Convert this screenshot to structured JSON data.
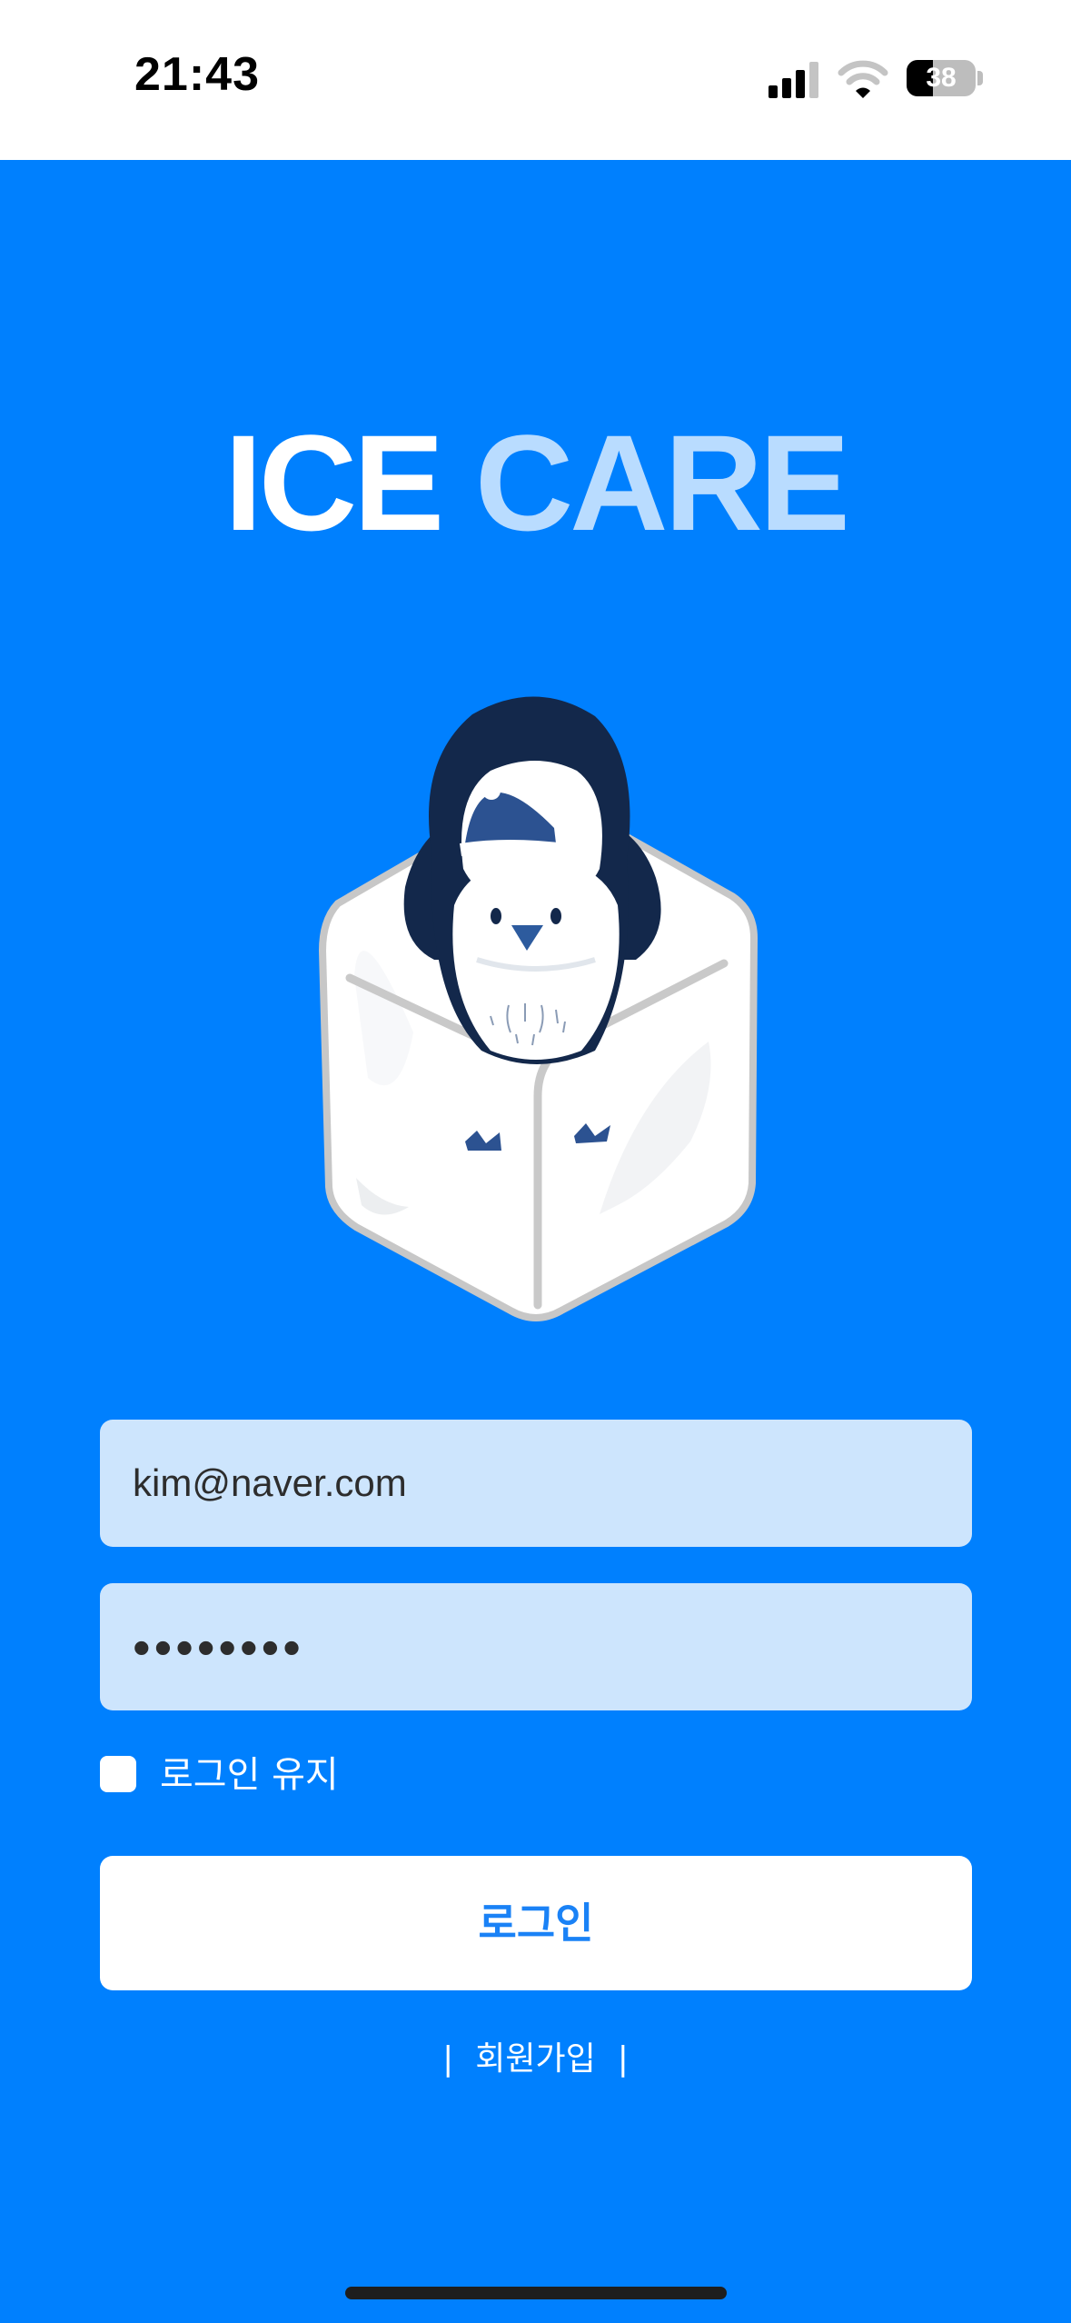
{
  "status_bar": {
    "time": "21:43",
    "battery_level": "38",
    "battery_fraction": 0.38
  },
  "logo": {
    "word1": "ICE",
    "word2": "CARE"
  },
  "login_form": {
    "email_value": "kim@naver.com",
    "password_value": "••••••••",
    "keep_login_label": "로그인 유지",
    "keep_login_checked": false,
    "login_button_label": "로그인",
    "separator": "|",
    "signup_link_label": "회원가입"
  },
  "icons": [
    "signal-icon",
    "wifi-icon",
    "battery-icon",
    "penguin-ice-cube-illustration",
    "checkbox-icon"
  ],
  "colors": {
    "background": "#0080fe",
    "input_background": "#cde5fd",
    "button_text": "#1a82f6",
    "logo_accent": "#b9dcff"
  }
}
